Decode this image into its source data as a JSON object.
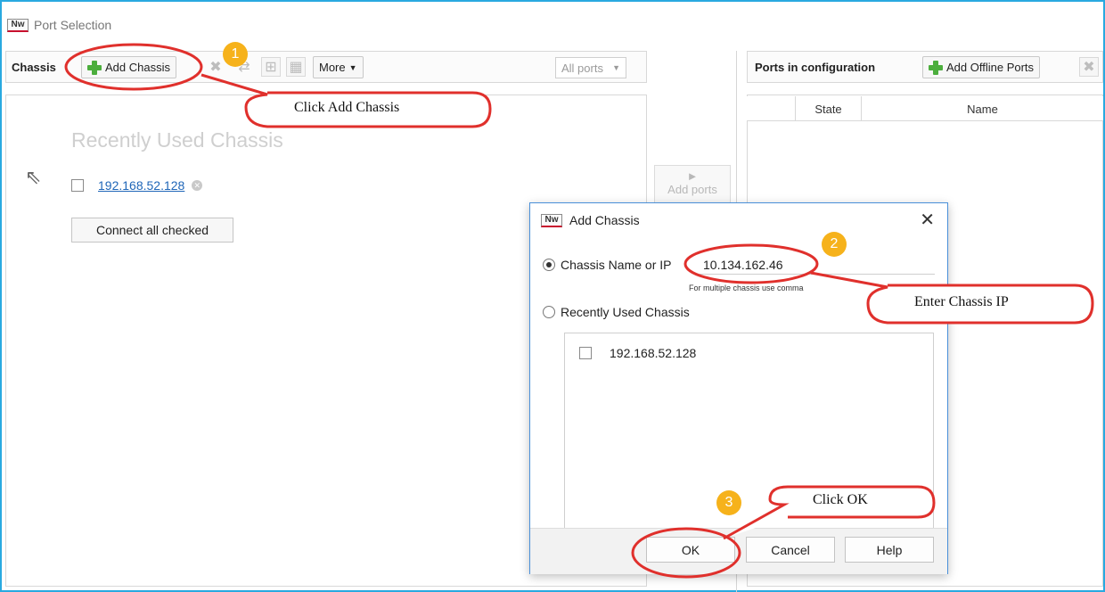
{
  "window": {
    "logo": "Nw",
    "title": "Port Selection"
  },
  "left_toolbar": {
    "label": "Chassis",
    "add_chassis": "Add Chassis",
    "more": "More",
    "filter_value": "All ports"
  },
  "left_panel": {
    "heading": "Recently Used Chassis",
    "items": [
      {
        "ip": "192.168.52.128"
      }
    ],
    "connect_button": "Connect all checked"
  },
  "middle": {
    "add_ports": "Add ports"
  },
  "right_toolbar": {
    "label": "Ports in configuration",
    "add_offline": "Add Offline Ports"
  },
  "right_grid": {
    "columns": [
      "State",
      "Name"
    ]
  },
  "dialog": {
    "logo": "Nw",
    "title": "Add Chassis",
    "option_name_ip": "Chassis Name or IP",
    "ip_value": "10.134.162.46",
    "hint": "For multiple chassis use comma",
    "option_recent": "Recently Used Chassis",
    "recent_items": [
      {
        "ip": "192.168.52.128"
      }
    ],
    "ok": "OK",
    "cancel": "Cancel",
    "help": "Help"
  },
  "annotations": {
    "step1": "1",
    "step2": "2",
    "step3": "3",
    "callout1": "Click Add Chassis",
    "callout2": "Enter Chassis IP",
    "callout3": "Click OK",
    "color_ellipse": "#e0302c",
    "color_badge": "#f6b21b"
  }
}
